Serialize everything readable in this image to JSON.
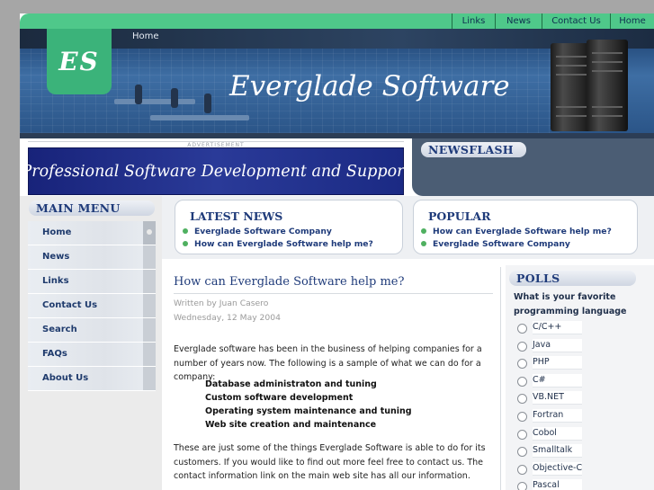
{
  "nav": {
    "links": [
      "Links",
      "News",
      "Contact Us",
      "Home"
    ]
  },
  "header": {
    "logo": "ES",
    "breadcrumb": "Home",
    "title": "Everglade Software"
  },
  "advert": {
    "label": "ADVERTISEMENT",
    "banner_text": "Professional Software Development and Support"
  },
  "newsflash": {
    "heading": "NEWSFLASH"
  },
  "main_menu": {
    "heading": "MAIN MENU",
    "items": [
      "Home",
      "News",
      "Links",
      "Contact Us",
      "Search",
      "FAQs",
      "About Us"
    ],
    "active": "Home"
  },
  "latest_news": {
    "heading": "LATEST NEWS",
    "items": [
      "Everglade Software Company",
      "How can Everglade Software help me?"
    ]
  },
  "popular": {
    "heading": "POPULAR",
    "items": [
      "How can Everglade Software help me?",
      "Everglade Software Company"
    ]
  },
  "article": {
    "title": "How can Everglade Software help me?",
    "author": "Written by Juan Casero",
    "date": "Wednesday, 12 May 2004",
    "intro": "Everglade software has been in the business of helping companies for a number of years now.  The following is a sample of what we can do for a company:",
    "services": [
      "Database administraton and tuning",
      "Custom software development",
      "Operating system maintenance and tuning",
      "Web site creation and maintenance"
    ],
    "outro": "These are just some of the things Everglade Software is able to do for its customers.  If you would like to find out more feel free to contact us.  The contact information link on the main web site has all our information."
  },
  "polls": {
    "heading": "POLLS",
    "question": "What is your favorite programming language",
    "options": [
      "C/C++",
      "Java",
      "PHP",
      "C#",
      "VB.NET",
      "Fortran",
      "Cobol",
      "Smalltalk",
      "Objective-C",
      "Pascal"
    ]
  },
  "colors": {
    "accent_green": "#4fc88a",
    "heading_blue": "#1f3b7a",
    "banner_navy": "#1b2a84"
  }
}
